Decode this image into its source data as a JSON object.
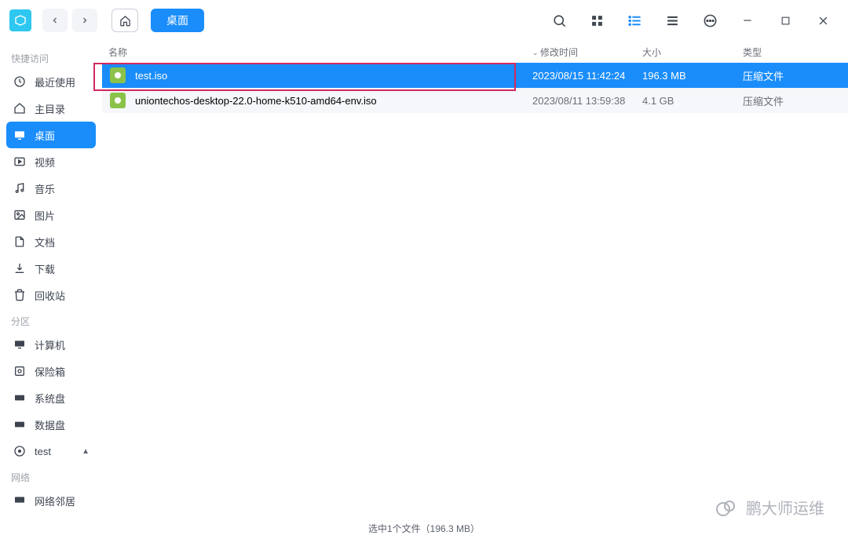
{
  "breadcrumb": {
    "current": "桌面"
  },
  "sidebar": {
    "sections": {
      "quick": "快捷访问",
      "partition": "分区",
      "network": "网络"
    },
    "items": [
      {
        "label": "最近使用"
      },
      {
        "label": "主目录"
      },
      {
        "label": "桌面"
      },
      {
        "label": "视频"
      },
      {
        "label": "音乐"
      },
      {
        "label": "图片"
      },
      {
        "label": "文档"
      },
      {
        "label": "下载"
      },
      {
        "label": "回收站"
      },
      {
        "label": "计算机"
      },
      {
        "label": "保险箱"
      },
      {
        "label": "系统盘"
      },
      {
        "label": "数据盘"
      },
      {
        "label": "test"
      },
      {
        "label": "网络邻居"
      }
    ]
  },
  "columns": {
    "name": "名称",
    "time": "修改时间",
    "size": "大小",
    "type": "类型"
  },
  "files": [
    {
      "name": "test.iso",
      "time": "2023/08/15 11:42:24",
      "size": "196.3 MB",
      "type": "压缩文件"
    },
    {
      "name": "uniontechos-desktop-22.0-home-k510-amd64-env.iso",
      "time": "2023/08/11 13:59:38",
      "size": "4.1 GB",
      "type": "压缩文件"
    }
  ],
  "status": {
    "text": "选中1个文件（196.3 MB）"
  },
  "watermark": {
    "text": "鹏大师运维"
  }
}
